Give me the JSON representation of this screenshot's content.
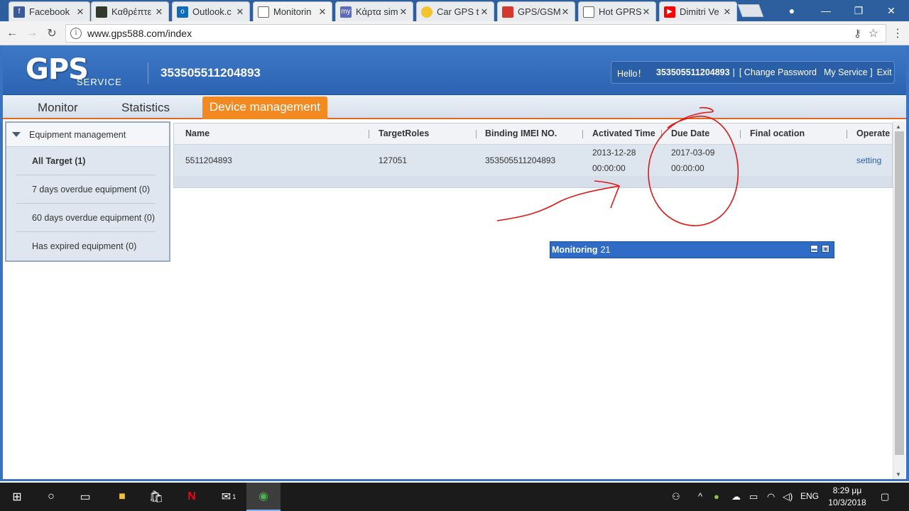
{
  "browser": {
    "tabs": [
      {
        "label": "Facebook",
        "favicon": "facebook-icon",
        "color": "#3b5998"
      },
      {
        "label": "Καθρέπτε",
        "favicon": "image-icon",
        "color": "#2f3a2a"
      },
      {
        "label": "Outlook.c",
        "favicon": "outlook-icon",
        "color": "#0f6cbd"
      },
      {
        "label": "Monitorin",
        "favicon": "page-icon",
        "color": "#ffffff"
      },
      {
        "label": "Κάρτα sim",
        "favicon": "my-icon",
        "color": "#5c6bc0"
      },
      {
        "label": "Car GPS t",
        "favicon": "smiley-icon",
        "color": "#f4c430"
      },
      {
        "label": "GPS/GSM",
        "favicon": "shop-icon",
        "color": "#d4372c"
      },
      {
        "label": "Hot GPRS",
        "favicon": "page-icon",
        "color": "#ffffff"
      },
      {
        "label": "Dimitri Ve",
        "favicon": "youtube-icon",
        "color": "#ff0000"
      }
    ],
    "url": "www.gps588.com/index"
  },
  "header": {
    "logo_main": "GPS",
    "logo_sub": "SERVICE",
    "device_title": "353505511204893",
    "user": {
      "hello": "Hello！",
      "name": "353505511204893",
      "sep": "|",
      "change_password": "[ Change Password",
      "my_service": "My Service ]",
      "exit": "Exit"
    }
  },
  "menu": {
    "monitor": "Monitor",
    "statistics": "Statistics",
    "device_management": "Device management"
  },
  "sidebar": {
    "title": "Equipment management",
    "items": [
      {
        "label": "All Target (1)"
      },
      {
        "label": "7 days overdue equipment (0)"
      },
      {
        "label": "60 days overdue equipment (0)"
      },
      {
        "label": "Has expired equipment (0)"
      }
    ]
  },
  "table": {
    "columns": [
      "Name",
      "TargetRoles",
      "Binding IMEI NO.",
      "Activated Time",
      "Due Date",
      "Final ocation",
      "Operate"
    ],
    "rows": [
      {
        "name": "5511204893",
        "target_roles": "127051",
        "imei": "353505511204893",
        "activated_date": "2013-12-28",
        "activated_time": "00:00:00",
        "due_date": "2017-03-09",
        "due_time": "00:00:00",
        "final_location": "",
        "operate": "setting"
      }
    ]
  },
  "monitoring_popup": {
    "label": "Monitoring",
    "count": "21"
  },
  "taskbar": {
    "language": "ENG",
    "time": "8:29 μμ",
    "date": "10/3/2018",
    "mail_badge": "1"
  },
  "colors": {
    "header_blue": "#2c64b2",
    "active_menu_orange": "#f28a21",
    "annotation_red": "#e01818"
  }
}
